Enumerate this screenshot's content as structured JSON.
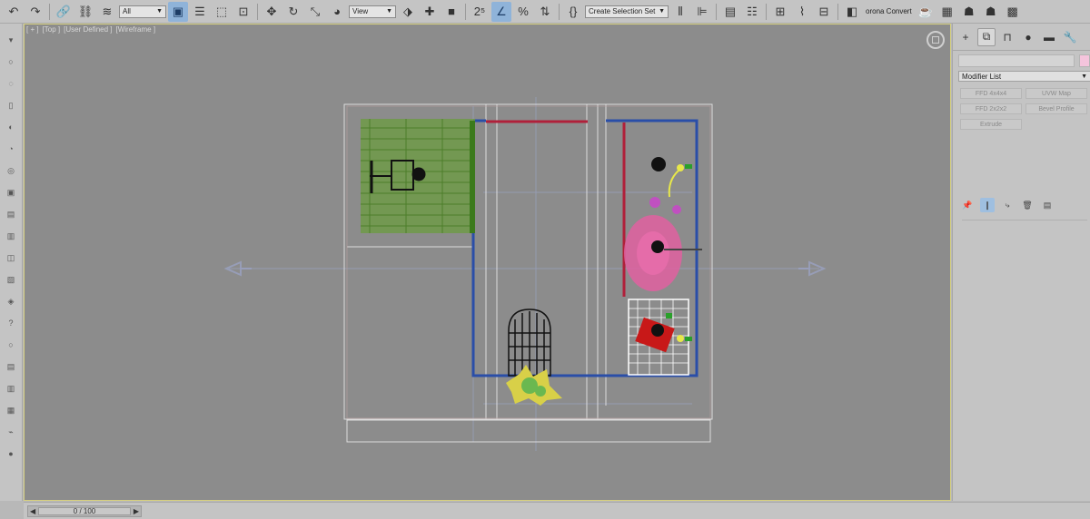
{
  "toolbar": {
    "filter_label": "All",
    "ref_coord_label": "View",
    "selection_set_label": "Create Selection Set",
    "converter_label": "orona Convert"
  },
  "viewport": {
    "label_plus": "[ + ]",
    "label_view": "[Top ]",
    "label_style": "[User Defined ]",
    "label_shading": "[Wireframe ]"
  },
  "command_panel": {
    "modifier_list_label": "Modifier List",
    "modifier_buttons": [
      "FFD 4x4x4",
      "UVW Map",
      "FFD 2x2x2",
      "Bevel Profile",
      "Extrude",
      ""
    ],
    "name_field_value": "",
    "object_color": "#f4c4dc"
  },
  "timeline": {
    "frame_readout": "0 / 100",
    "current_frame": 0,
    "total_frames": 100
  },
  "colors": {
    "viewport_bg": "#8c8c8c",
    "wall_lines": "#2a4ea8",
    "accent_highlight": "#8fb3d9",
    "active_viewport_border": "#d6d080"
  }
}
